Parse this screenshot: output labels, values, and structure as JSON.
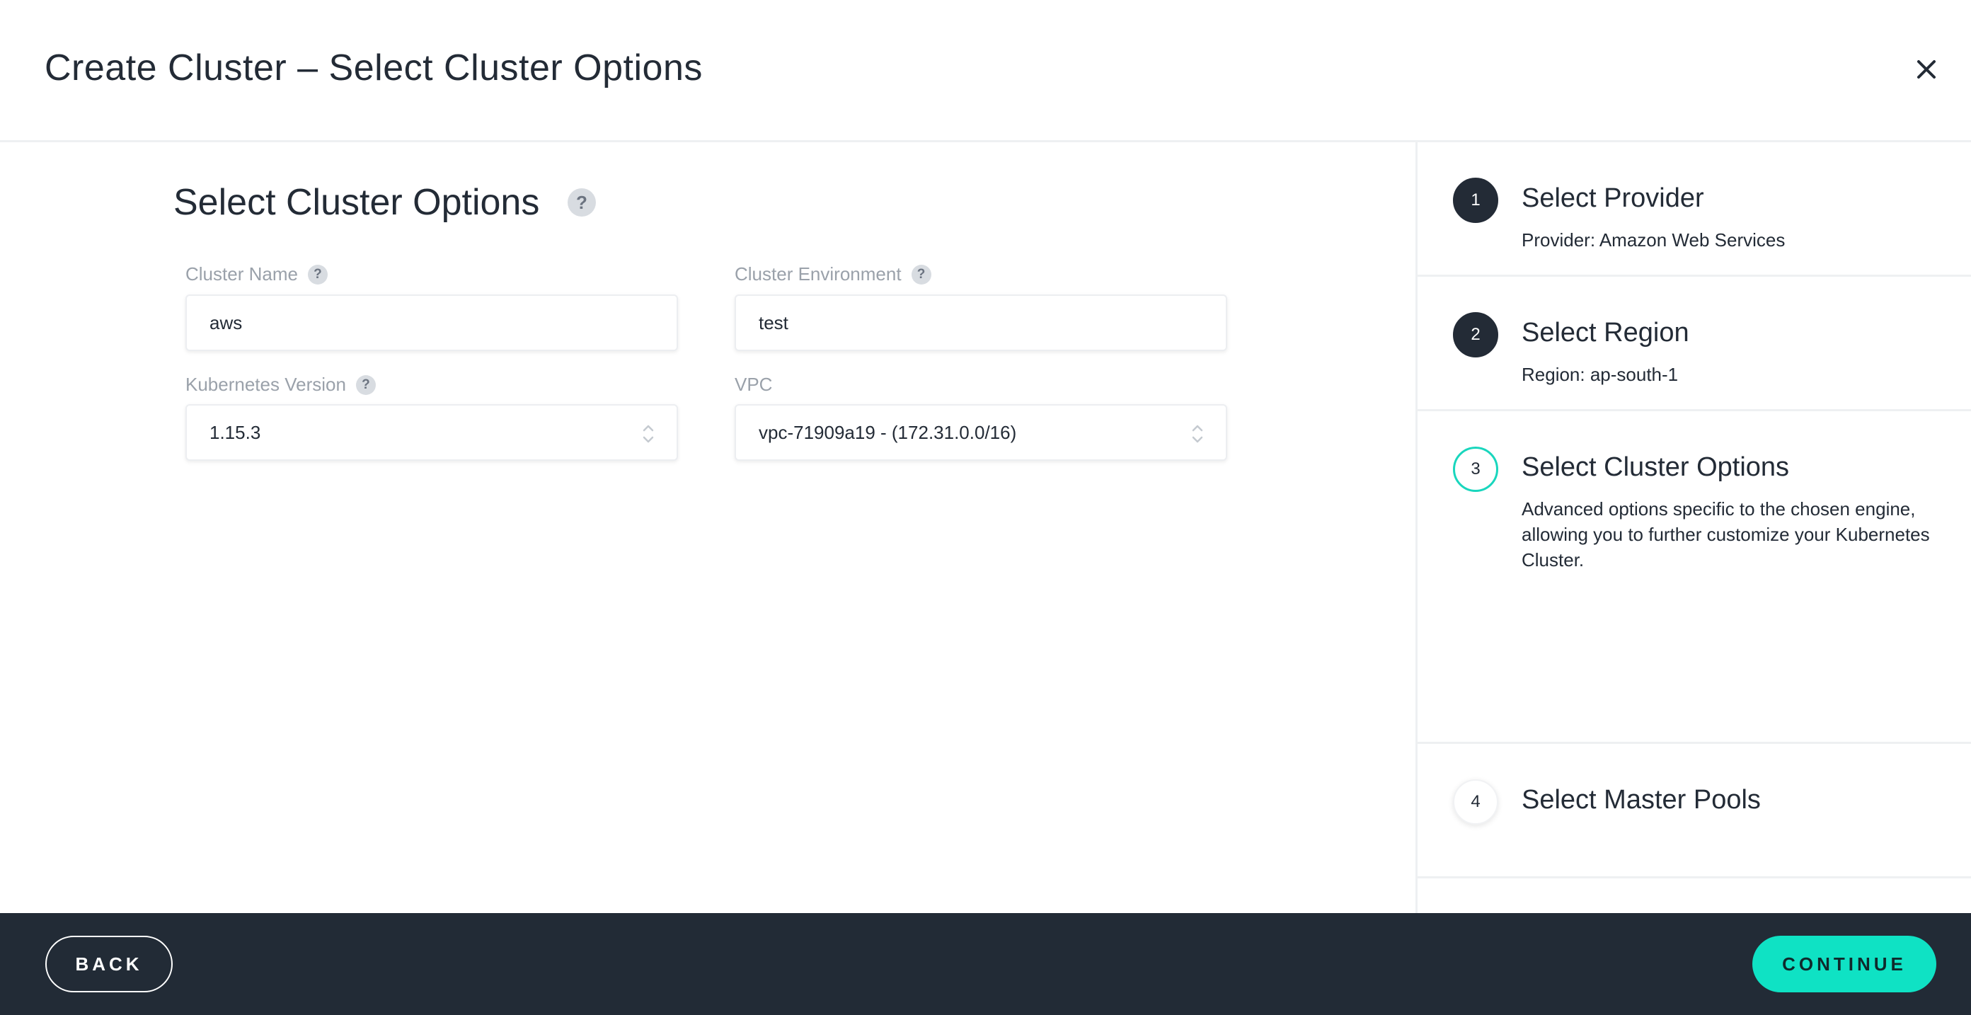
{
  "header": {
    "title": "Create Cluster – Select Cluster Options",
    "close_icon": "close-icon"
  },
  "main": {
    "section_title": "Select Cluster Options",
    "help_glyph": "?",
    "fields": {
      "cluster_name": {
        "label": "Cluster Name",
        "value": "aws"
      },
      "cluster_environment": {
        "label": "Cluster Environment",
        "value": "test"
      },
      "kubernetes_version": {
        "label": "Kubernetes Version",
        "value": "1.15.3"
      },
      "vpc": {
        "label": "VPC",
        "value": "vpc-71909a19 - (172.31.0.0/16)"
      }
    }
  },
  "steps": [
    {
      "number": "1",
      "title": "Select Provider",
      "description": "Provider: Amazon Web Services",
      "state": "done"
    },
    {
      "number": "2",
      "title": "Select Region",
      "description": "Region: ap-south-1",
      "state": "done"
    },
    {
      "number": "3",
      "title": "Select Cluster Options",
      "description": "Advanced options specific to the chosen engine, allowing you to further customize your Kubernetes Cluster.",
      "state": "active"
    },
    {
      "number": "4",
      "title": "Select Master Pools",
      "description": "",
      "state": "pending"
    }
  ],
  "footer": {
    "back_label": "BACK",
    "continue_label": "CONTINUE"
  },
  "colors": {
    "accent": "#0fe2c4",
    "active_ring": "#19d6bd",
    "dark": "#222b36"
  }
}
